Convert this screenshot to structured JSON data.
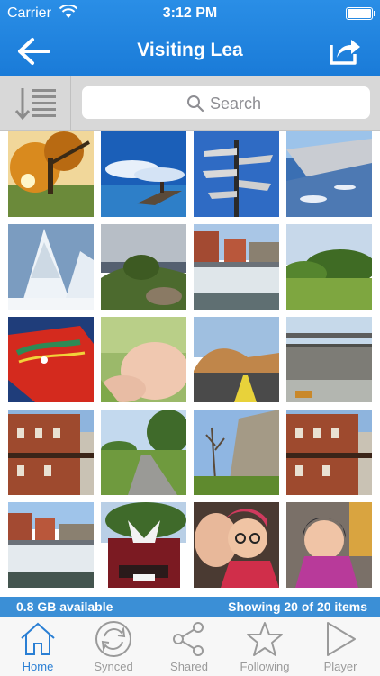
{
  "status": {
    "carrier": "Carrier",
    "time": "3:12 PM"
  },
  "nav": {
    "title": "Visiting Lea"
  },
  "search": {
    "placeholder": "Search"
  },
  "photos": [
    "autumn tree",
    "ocean pier",
    "signpost",
    "airplane wing",
    "snowy trees",
    "coastal rocks",
    "waterfall dam",
    "green field",
    "red dala horse",
    "baby face",
    "rocky road",
    "weir",
    "brick building",
    "park path",
    "castle ruin",
    "brick building",
    "waterfall town",
    "car trunk",
    "selfie",
    "child in pink"
  ],
  "info": {
    "available": "0.8 GB available",
    "showing": "Showing 20 of 20 items"
  },
  "tabs": [
    {
      "label": "Home",
      "icon": "home-icon",
      "active": true
    },
    {
      "label": "Synced",
      "icon": "sync-icon",
      "active": false
    },
    {
      "label": "Shared",
      "icon": "share-network-icon",
      "active": false
    },
    {
      "label": "Following",
      "icon": "star-icon",
      "active": false
    },
    {
      "label": "Player",
      "icon": "play-icon",
      "active": false
    }
  ],
  "colors": {
    "accent": "#1a7bd8",
    "infobar": "#3b8fd6",
    "tab_active": "#2a7fd4",
    "tab_inactive": "#9a9a9a"
  }
}
